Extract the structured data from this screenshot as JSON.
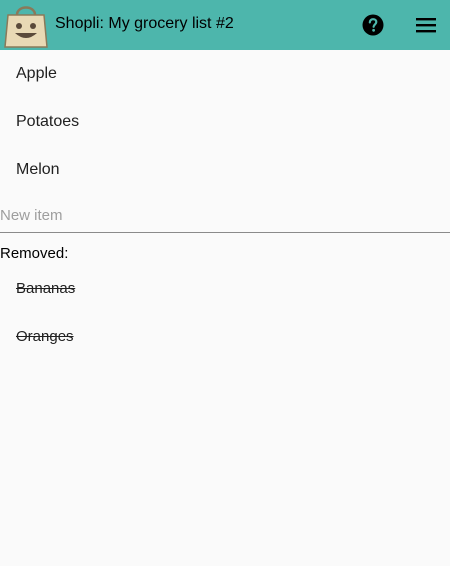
{
  "app_bar": {
    "title": "Shopli: My grocery list #2",
    "logo_icon": "grocery-bag-smiley-icon",
    "help_icon": "help-circle-icon",
    "menu_icon": "hamburger-menu-icon",
    "background_color": "#4db6ac"
  },
  "items": [
    {
      "label": "Apple"
    },
    {
      "label": "Potatoes"
    },
    {
      "label": "Melon"
    }
  ],
  "new_item": {
    "placeholder": "New item",
    "value": ""
  },
  "removed": {
    "heading": "Removed:",
    "items": [
      {
        "label": "Bananas"
      },
      {
        "label": "Oranges"
      }
    ]
  }
}
